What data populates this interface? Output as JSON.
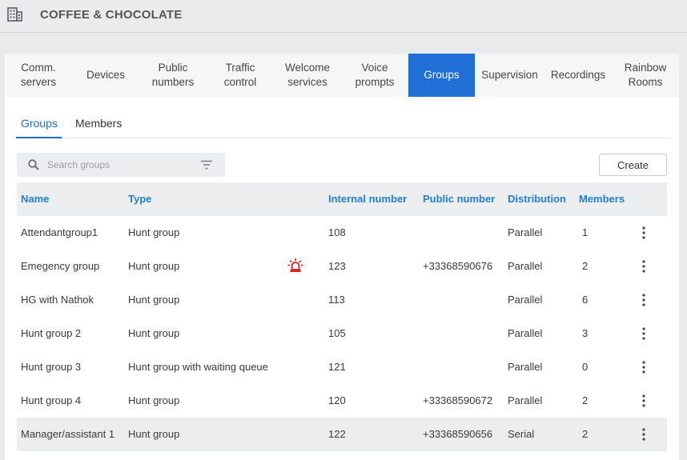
{
  "header": {
    "company": "COFFEE & CHOCOLATE",
    "icon": "building-icon"
  },
  "tabs": [
    {
      "label": "Comm.\nservers"
    },
    {
      "label": "Devices"
    },
    {
      "label": "Public\nnumbers"
    },
    {
      "label": "Traffic\ncontrol"
    },
    {
      "label": "Welcome\nservices"
    },
    {
      "label": "Voice\nprompts"
    },
    {
      "label": "Groups",
      "active": true
    },
    {
      "label": "Supervision"
    },
    {
      "label": "Recordings"
    },
    {
      "label": "Rainbow\nRooms"
    }
  ],
  "subtabs": {
    "groups": "Groups",
    "members": "Members"
  },
  "search": {
    "placeholder": "Search groups"
  },
  "actions": {
    "create": "Create"
  },
  "table": {
    "columns": {
      "name": "Name",
      "type": "Type",
      "internal": "Internal number",
      "public": "Public number",
      "distribution": "Distribution",
      "members": "Members"
    },
    "rows": [
      {
        "name": "Attendantgroup1",
        "type": "Hunt group",
        "internal": "108",
        "public": "",
        "distribution": "Parallel",
        "members": "1"
      },
      {
        "name": "Emegency group",
        "type": "Hunt group",
        "internal": "123",
        "public": "+33368590676",
        "distribution": "Parallel",
        "members": "2",
        "alarm": true
      },
      {
        "name": "HG with Nathok",
        "type": "Hunt group",
        "internal": "113",
        "public": "",
        "distribution": "Parallel",
        "members": "6"
      },
      {
        "name": "Hunt group 2",
        "type": "Hunt group",
        "internal": "105",
        "public": "",
        "distribution": "Parallel",
        "members": "3"
      },
      {
        "name": "Hunt group 3",
        "type": "Hunt group with waiting queue",
        "internal": "121",
        "public": "",
        "distribution": "Parallel",
        "members": "0"
      },
      {
        "name": "Hunt group 4",
        "type": "Hunt group",
        "internal": "120",
        "public": "+33368590672",
        "distribution": "Parallel",
        "members": "2"
      },
      {
        "name": "Manager/assistant 1",
        "type": "Hunt group",
        "internal": "122",
        "public": "+33368590656",
        "distribution": "Serial",
        "members": "2",
        "highlight": true
      }
    ]
  },
  "colors": {
    "accent": "#1f6fd6",
    "header_text": "#1f7fd9",
    "alarm": "#e0201b"
  }
}
